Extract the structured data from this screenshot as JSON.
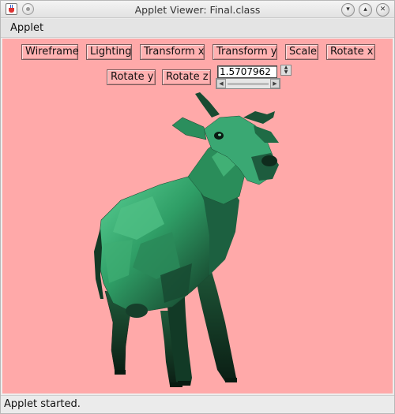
{
  "window": {
    "title": "Applet Viewer: Final.class"
  },
  "menubar": {
    "items": [
      {
        "label": "Applet"
      }
    ]
  },
  "toolbar": {
    "buttons": [
      {
        "id": "wireframe",
        "label": "Wireframe"
      },
      {
        "id": "lighting",
        "label": "Lighting"
      },
      {
        "id": "transform-x",
        "label": "Transform x"
      },
      {
        "id": "transform-y",
        "label": "Transform y"
      },
      {
        "id": "scale",
        "label": "Scale"
      },
      {
        "id": "rotate-x",
        "label": "Rotate x"
      },
      {
        "id": "rotate-y",
        "label": "Rotate y"
      },
      {
        "id": "rotate-z",
        "label": "Rotate z"
      }
    ],
    "angle_value": "1.5707962"
  },
  "scene": {
    "background_color": "#ffa9a9",
    "model_color": "#2f9e66",
    "model_shadow_color": "#0f2a1c",
    "model_highlight_color": "#5fd69a"
  },
  "status": {
    "text": "Applet started."
  }
}
